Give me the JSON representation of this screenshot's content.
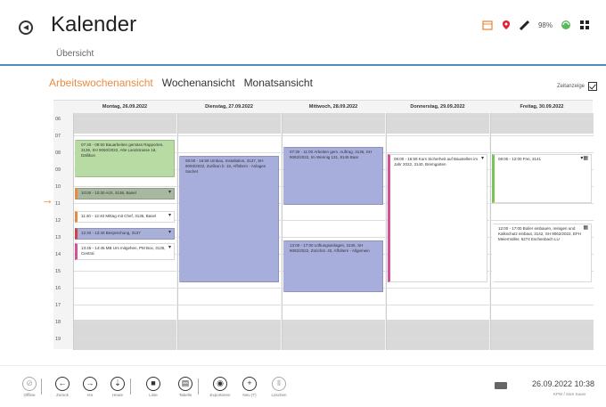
{
  "header": {
    "title": "Kalender",
    "subtitle": "Übersicht",
    "battery": "98%",
    "accent_color": "#4a8fc4"
  },
  "views": {
    "tabs": [
      "Arbeitswochenansicht",
      "Wochenansicht",
      "Monatsansicht"
    ],
    "active_color": "#e98b3f",
    "zeitanzeige_label": "Zeitanzeige"
  },
  "calendar": {
    "days": [
      "Montag, 26.09.2022",
      "Dienstag, 27.09.2022",
      "Mittwoch, 28.09.2022",
      "Donnerstag, 29.09.2022",
      "Freitag, 30.09.2022"
    ],
    "hours": [
      "06",
      "07",
      "08",
      "09",
      "10",
      "11",
      "12",
      "13",
      "14",
      "15",
      "16",
      "17",
      "18",
      "19"
    ],
    "events": [
      {
        "day": 0,
        "start": 7.2,
        "end": 9.4,
        "color": "#b8dba4",
        "border": "#b8dba4",
        "text": "07:40 - 09:50 Bauarbeiten gemäss Rapporten, 3135, SH 9050/2022, Alte Landstrasse 18, Dällikon"
      },
      {
        "day": 0,
        "start": 10.0,
        "end": 10.7,
        "color": "#a8b8a0",
        "border": "#e98b3f",
        "text": "10:00 - 10:30 Arzt, 3136, Basel",
        "k": "▾"
      },
      {
        "day": 0,
        "start": 11.4,
        "end": 12.1,
        "color": "#ffffff",
        "border": "#e98b3f",
        "text": "11:40 - 12:40 Mittag mit Chef, 3136, Basel",
        "k": "▾"
      },
      {
        "day": 0,
        "start": 12.4,
        "end": 13.1,
        "color": "#a8b0d8",
        "border": "#c44",
        "text": "12:40 - 13:40 Besprechung, 3137",
        "k": "▾"
      },
      {
        "day": 0,
        "start": 13.3,
        "end": 14.3,
        "color": "#ffffff",
        "border": "#d4509a",
        "text": "13:45 - 14:45 MB Urs mitgehen, PM Box, 3135, Central",
        "k": "▾"
      },
      {
        "day": 1,
        "start": 8.1,
        "end": 15.6,
        "color": "#a8aedc",
        "border": "#a8aedc",
        "text": "08:00 - 16:59 Umbau, Installation, 3137, SH 9093/2022, Zurlikon b. 15, Affoltern - Anlagen Sachet"
      },
      {
        "day": 2,
        "start": 7.6,
        "end": 11.0,
        "color": "#a8aedc",
        "border": "#a8aedc",
        "text": "07:30 - 11:00 Arbeiten gem. Auftrag, 3136, SH 9082/2022, Im Wennig 131, 8145 Baar"
      },
      {
        "day": 2,
        "start": 13.1,
        "end": 16.2,
        "color": "#a8aedc",
        "border": "#a8aedc",
        "text": "13:00 - 17:00 Lüftungsanlagen, 3136, SH 9092/2022, Zürichst. 40, Affoltern - Allgemein"
      },
      {
        "day": 3,
        "start": 8.0,
        "end": 15.6,
        "color": "#ffffff",
        "border": "#d4509a",
        "text": "08:00 - 16:59 Kurs Sicherheit auf Baustellen im Jahr 2022, 3140, Bremgarten",
        "k": "▾"
      },
      {
        "day": 4,
        "start": 8.0,
        "end": 10.9,
        "color": "#ffffff",
        "border": "#7cc25a",
        "text": "08:00 - 12:00 Frei, 3141",
        "k": "▾▦"
      },
      {
        "day": 4,
        "start": 12.1,
        "end": 15.6,
        "color": "#ffffff",
        "border": "#ffffff",
        "text": "12:00 - 17:00 Boiler einbauen, reinigen und Kalkschutz einbaut, 3142, SH 9062/2022, EFH Meiermüller, 6274 Eschenbach LU",
        "k": "▦"
      }
    ]
  },
  "toolbar": {
    "buttons": [
      {
        "label": "Offline",
        "glyph": "⊘",
        "dim": true
      },
      {
        "label": "Zurück",
        "glyph": "←"
      },
      {
        "label": "Vor",
        "glyph": "→"
      },
      {
        "label": "Heute",
        "glyph": "⇣"
      },
      {
        "label": "Liste",
        "glyph": "■"
      },
      {
        "label": "Tabelle",
        "glyph": "▤"
      },
      {
        "label": "Exportieren",
        "glyph": "◉"
      },
      {
        "label": "Neu (T)",
        "glyph": "+"
      },
      {
        "label": "Löschen",
        "glyph": "Ⅱ",
        "dim": true
      }
    ],
    "datetime": "26.09.2022 10:38",
    "datetime_sub": "KPW / Sam Sauer"
  }
}
